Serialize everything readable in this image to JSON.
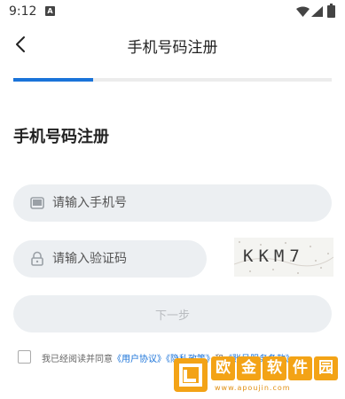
{
  "status_bar": {
    "time": "9:12",
    "app_icon_letter": "A"
  },
  "header": {
    "back_icon": "chevron-left-icon",
    "title": "手机号码注册"
  },
  "progress": {
    "fraction": 0.25,
    "color": "#1a73d9"
  },
  "form": {
    "heading": "手机号码注册",
    "phone_placeholder": "请输入手机号",
    "phone_icon": "phone-icon",
    "code_placeholder": "请输入验证码",
    "code_icon": "lock-icon",
    "captcha_text": "KKM7",
    "next_label": "下一步"
  },
  "agreement": {
    "prefix": "我已经阅读并同意",
    "user_agreement": "《用户协议》",
    "privacy_policy": "《隐私政策》",
    "and": "和",
    "account_policy": "《账号服务条款》"
  },
  "watermark": {
    "chars": [
      "欧",
      "金",
      "软",
      "件",
      "园"
    ],
    "url": "www.apoujin.com"
  },
  "colors": {
    "accent": "#1a73d9",
    "field_bg": "#eceff2",
    "watermark": "#f3a316"
  }
}
